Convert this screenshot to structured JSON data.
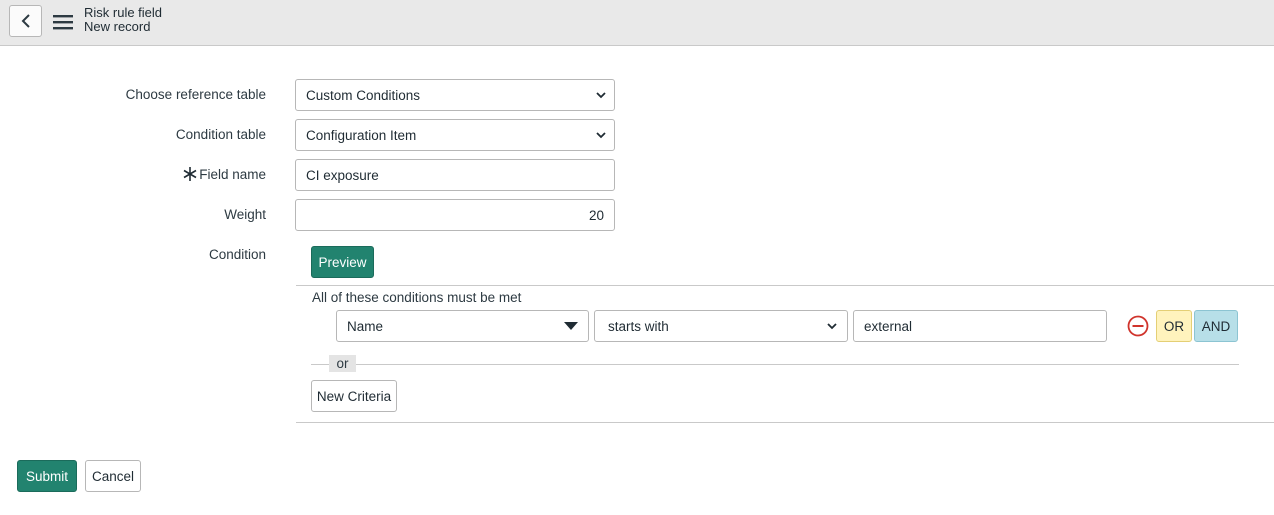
{
  "header": {
    "title": "Risk rule field",
    "subtitle": "New record",
    "back_icon": "chevron-left-icon",
    "menu_icon": "hamburger-menu-icon"
  },
  "form": {
    "reference_table": {
      "label": "Choose reference table",
      "value": "Custom Conditions"
    },
    "condition_table": {
      "label": "Condition table",
      "value": "Configuration Item"
    },
    "field_name": {
      "label": "Field name",
      "value": "CI exposure",
      "required": true
    },
    "weight": {
      "label": "Weight",
      "value": "20"
    },
    "condition": {
      "label": "Condition",
      "preview_label": "Preview",
      "heading": "All of these conditions must be met",
      "rows": [
        {
          "field": "Name",
          "operator": "starts with",
          "value": "external"
        }
      ],
      "or_label": "OR",
      "and_label": "AND",
      "separator_label": "or",
      "new_criteria_label": "New Criteria"
    }
  },
  "footer": {
    "submit_label": "Submit",
    "cancel_label": "Cancel"
  },
  "colors": {
    "primary": "#22836f",
    "or_button": "#fff3bd",
    "and_button": "#b7dfe8",
    "remove_icon": "#d0342c",
    "header_bg": "#e9e9e9"
  }
}
